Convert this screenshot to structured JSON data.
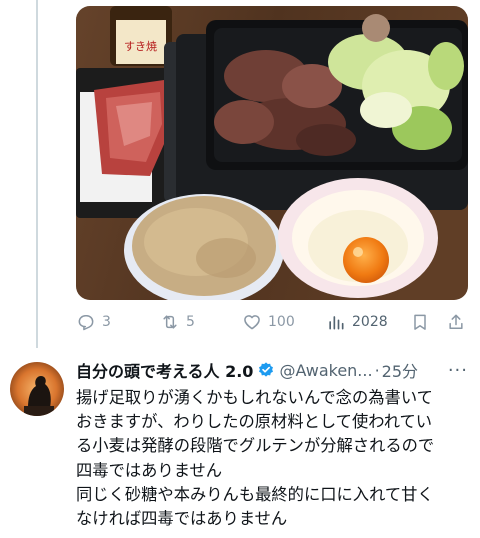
{
  "tweet_media": {
    "alt": ""
  },
  "actions": {
    "reply_count": "3",
    "retweet_count": "5",
    "like_count": "100",
    "view_count": "2028"
  },
  "reply": {
    "display_name": "自分の頭で考える人 2.0",
    "handle": "@Awaken...",
    "separator": "·",
    "time": "25分",
    "more": "···",
    "lines": [
      "揚げ足取りが湧くかもしれないんで念の為書いて",
      "おきますが、わりしたの原材料として使われてい",
      "る小麦は発酵の段階でグルテンが分解されるので",
      "四毒ではありません",
      "同じく砂糖や本みりんも最終的に口に入れて甘く",
      "なければ四毒ではありません"
    ]
  },
  "bottle_label": "すき焼",
  "colors": {
    "icon_gray": "#8b98a5",
    "verified_blue": "#1d9bf0",
    "text": "#0f1419",
    "secondary": "#536471"
  }
}
